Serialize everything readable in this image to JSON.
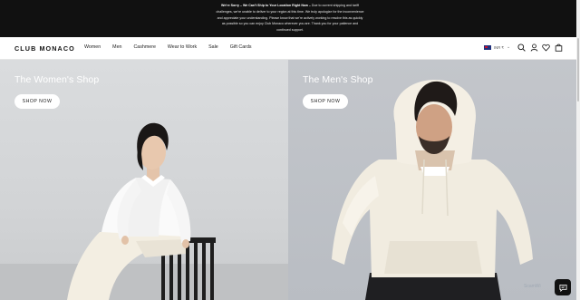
{
  "banner": {
    "headline": "We're Sorry – We Can't Ship to Your Location Right Now –",
    "lines": [
      "Due to current shipping and tariff",
      "challenges, we're unable to deliver to your region at this time. We truly apologize for the inconvenience",
      "and appreciate your understanding. Please know that we're actively working to resolve this as quickly",
      "as possible so you can enjoy Club Monaco wherever you are. Thank you for your patience and",
      "continued support."
    ]
  },
  "header": {
    "logo": "CLUB MONACO",
    "nav": [
      "Women",
      "Men",
      "Cashmere",
      "Wear to Work",
      "Sale",
      "Gift Cards"
    ],
    "locale": "INR ₹",
    "icons": [
      "search-icon",
      "account-icon",
      "wishlist-icon",
      "bag-icon"
    ]
  },
  "hero": {
    "women": {
      "title": "The Women's Shop",
      "button": "SHOP NOW"
    },
    "men": {
      "title": "The Men's Shop",
      "button": "SHOP NOW"
    }
  },
  "widget": {
    "watermark": "ScamWi"
  },
  "colors": {
    "banner_bg": "#111111",
    "women_bg": "#d4d6d8",
    "men_bg": "#bcc0c5"
  }
}
